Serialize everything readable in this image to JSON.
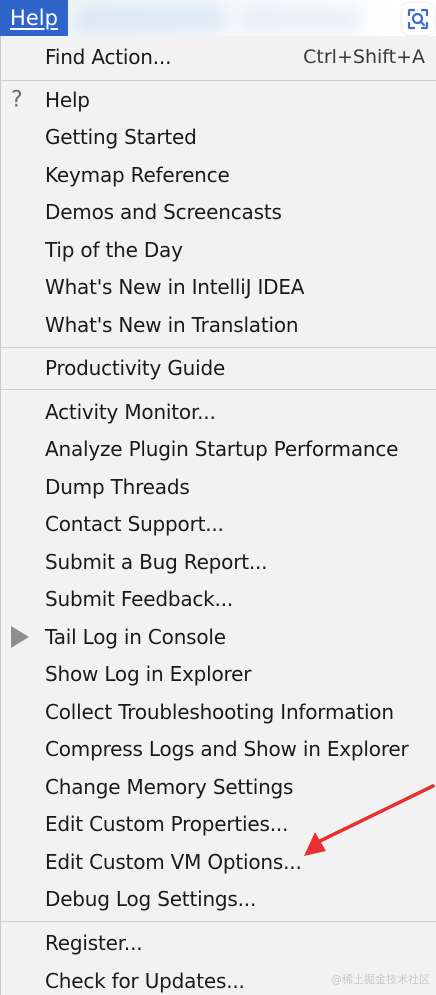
{
  "menu_bar": {
    "help_label": "Help"
  },
  "menu": {
    "find_action": {
      "label": "Find Action...",
      "shortcut": "Ctrl+Shift+A"
    },
    "group1": [
      {
        "label": "Help"
      },
      {
        "label": "Getting Started"
      },
      {
        "label": "Keymap Reference"
      },
      {
        "label": "Demos and Screencasts"
      },
      {
        "label": "Tip of the Day"
      },
      {
        "label": "What's New in IntelliJ IDEA"
      },
      {
        "label": "What's New in Translation"
      }
    ],
    "group2": [
      {
        "label": "Productivity Guide"
      }
    ],
    "group3": [
      {
        "label": "Activity Monitor..."
      },
      {
        "label": "Analyze Plugin Startup Performance"
      },
      {
        "label": "Dump Threads"
      },
      {
        "label": "Contact Support..."
      },
      {
        "label": "Submit a Bug Report..."
      },
      {
        "label": "Submit Feedback..."
      },
      {
        "label": "Tail Log in Console"
      },
      {
        "label": "Show Log in Explorer"
      },
      {
        "label": "Collect Troubleshooting Information"
      },
      {
        "label": "Compress Logs and Show in Explorer"
      },
      {
        "label": "Change Memory Settings"
      },
      {
        "label": "Edit Custom Properties..."
      },
      {
        "label": "Edit Custom VM Options..."
      },
      {
        "label": "Debug Log Settings..."
      }
    ],
    "group4": [
      {
        "label": "Register..."
      },
      {
        "label": "Check for Updates..."
      }
    ]
  },
  "icons": {
    "help": "question-mark-icon",
    "tail_log": "play-triangle-icon",
    "lens": "scan-lens-icon"
  },
  "colors": {
    "menu_tab_bg": "#2f65ca",
    "annotation_arrow": "#e8312f"
  },
  "watermark": "@稀土掘金技术社区"
}
